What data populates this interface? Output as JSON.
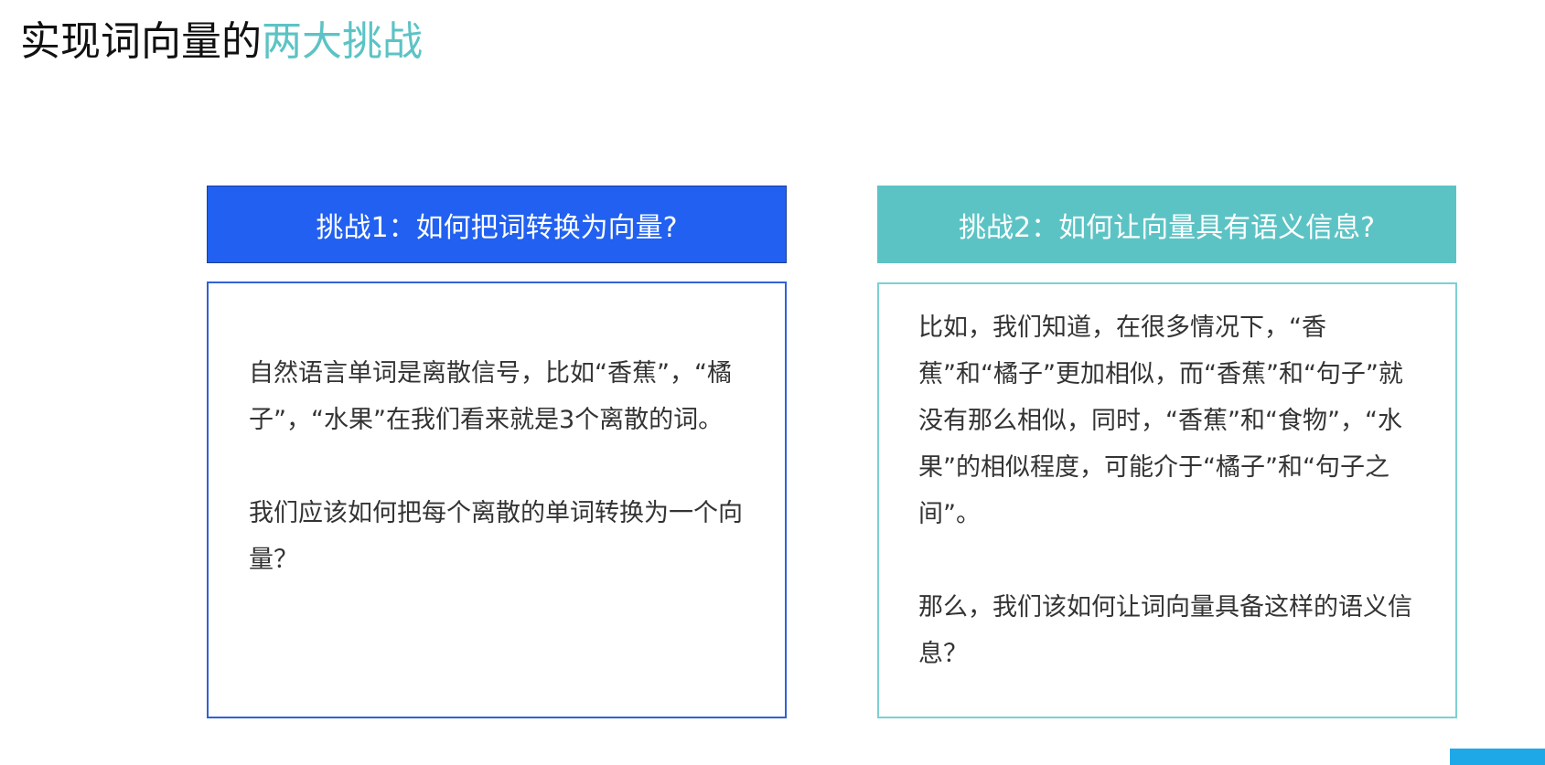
{
  "slide": {
    "title_main": "实现词向量的",
    "title_accent": "两大挑战",
    "accent_color": "#5cc3c5"
  },
  "challenge1": {
    "header": "挑战1：如何把词转换为向量?",
    "header_color": "#2160f0",
    "paragraphs": [
      "自然语言单词是离散信号，比如“香蕉”，“橘子”，“水果”在我们看来就是3个离散的词。",
      "我们应该如何把每个离散的单词转换为一个向量？"
    ]
  },
  "challenge2": {
    "header": "挑战2：如何让向量具有语义信息?",
    "header_color": "#5cc3c5",
    "paragraphs": [
      "比如，我们知道，在很多情况下，“香蕉”和“橘子”更加相似，而“香蕉”和“句子”就没有那么相似，同时，“香蕉”和“食物”，“水果”的相似程度，可能介于“橘子”和“句子之间”。",
      "那么，我们该如何让词向量具备这样的语义信息？"
    ]
  }
}
